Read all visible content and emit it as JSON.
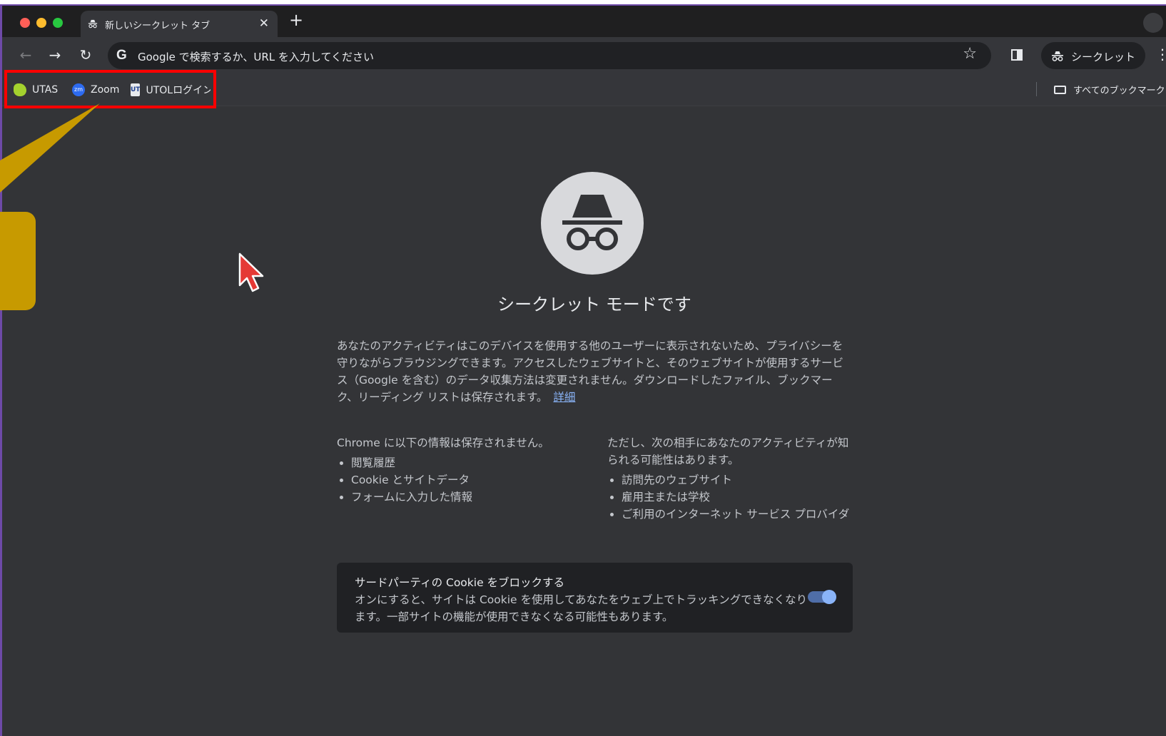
{
  "window": {
    "tab_title": "新しいシークレット タブ",
    "tab_close": "✕",
    "new_tab": "+"
  },
  "toolbar": {
    "omnibox_placeholder": "Google で検索するか、URL を入力してください",
    "google_icon": "G",
    "incognito_label": "シークレット"
  },
  "bookmarks": {
    "items": [
      {
        "label": "UTAS",
        "icon": "utas-icon"
      },
      {
        "label": "Zoom",
        "icon": "zoom-icon",
        "icon_text": "zm"
      },
      {
        "label": "UTOLログイン",
        "icon": "utol-icon",
        "icon_text": "UT"
      }
    ],
    "all_bookmarks": "すべてのブックマーク"
  },
  "page": {
    "title": "シークレット モードです",
    "description": "あなたのアクティビティはこのデバイスを使用する他のユーザーに表示されないため、プライバシーを守りながらブラウジングできます。アクセスしたウェブサイトと、そのウェブサイトが使用するサービス（Google を含む）のデータ収集方法は変更されません。ダウンロードしたファイル、ブックマーク、リーディング リストは保存されます。",
    "learn_more": "詳細",
    "not_saved_heading": "Chrome に以下の情報は保存されません。",
    "not_saved_items": [
      "閲覧履歴",
      "Cookie とサイトデータ",
      "フォームに入力した情報"
    ],
    "visible_heading": "ただし、次の相手にあなたのアクティビティが知られる可能性はあります。",
    "visible_items": [
      "訪問先のウェブサイト",
      "雇用主または学校",
      "ご利用のインターネット サービス プロバイダ"
    ],
    "cookie_title": "サードパーティの Cookie をブロックする",
    "cookie_desc": "オンにすると、サイトは Cookie を使用してあなたをウェブ上でトラッキングできなくなります。一部サイトの機能が使用できなくなる可能性もあります。",
    "cookie_toggle_on": true
  },
  "colors": {
    "accent": "#8ab4f8",
    "highlight": "#ff0000",
    "callout": "#c79a00"
  }
}
